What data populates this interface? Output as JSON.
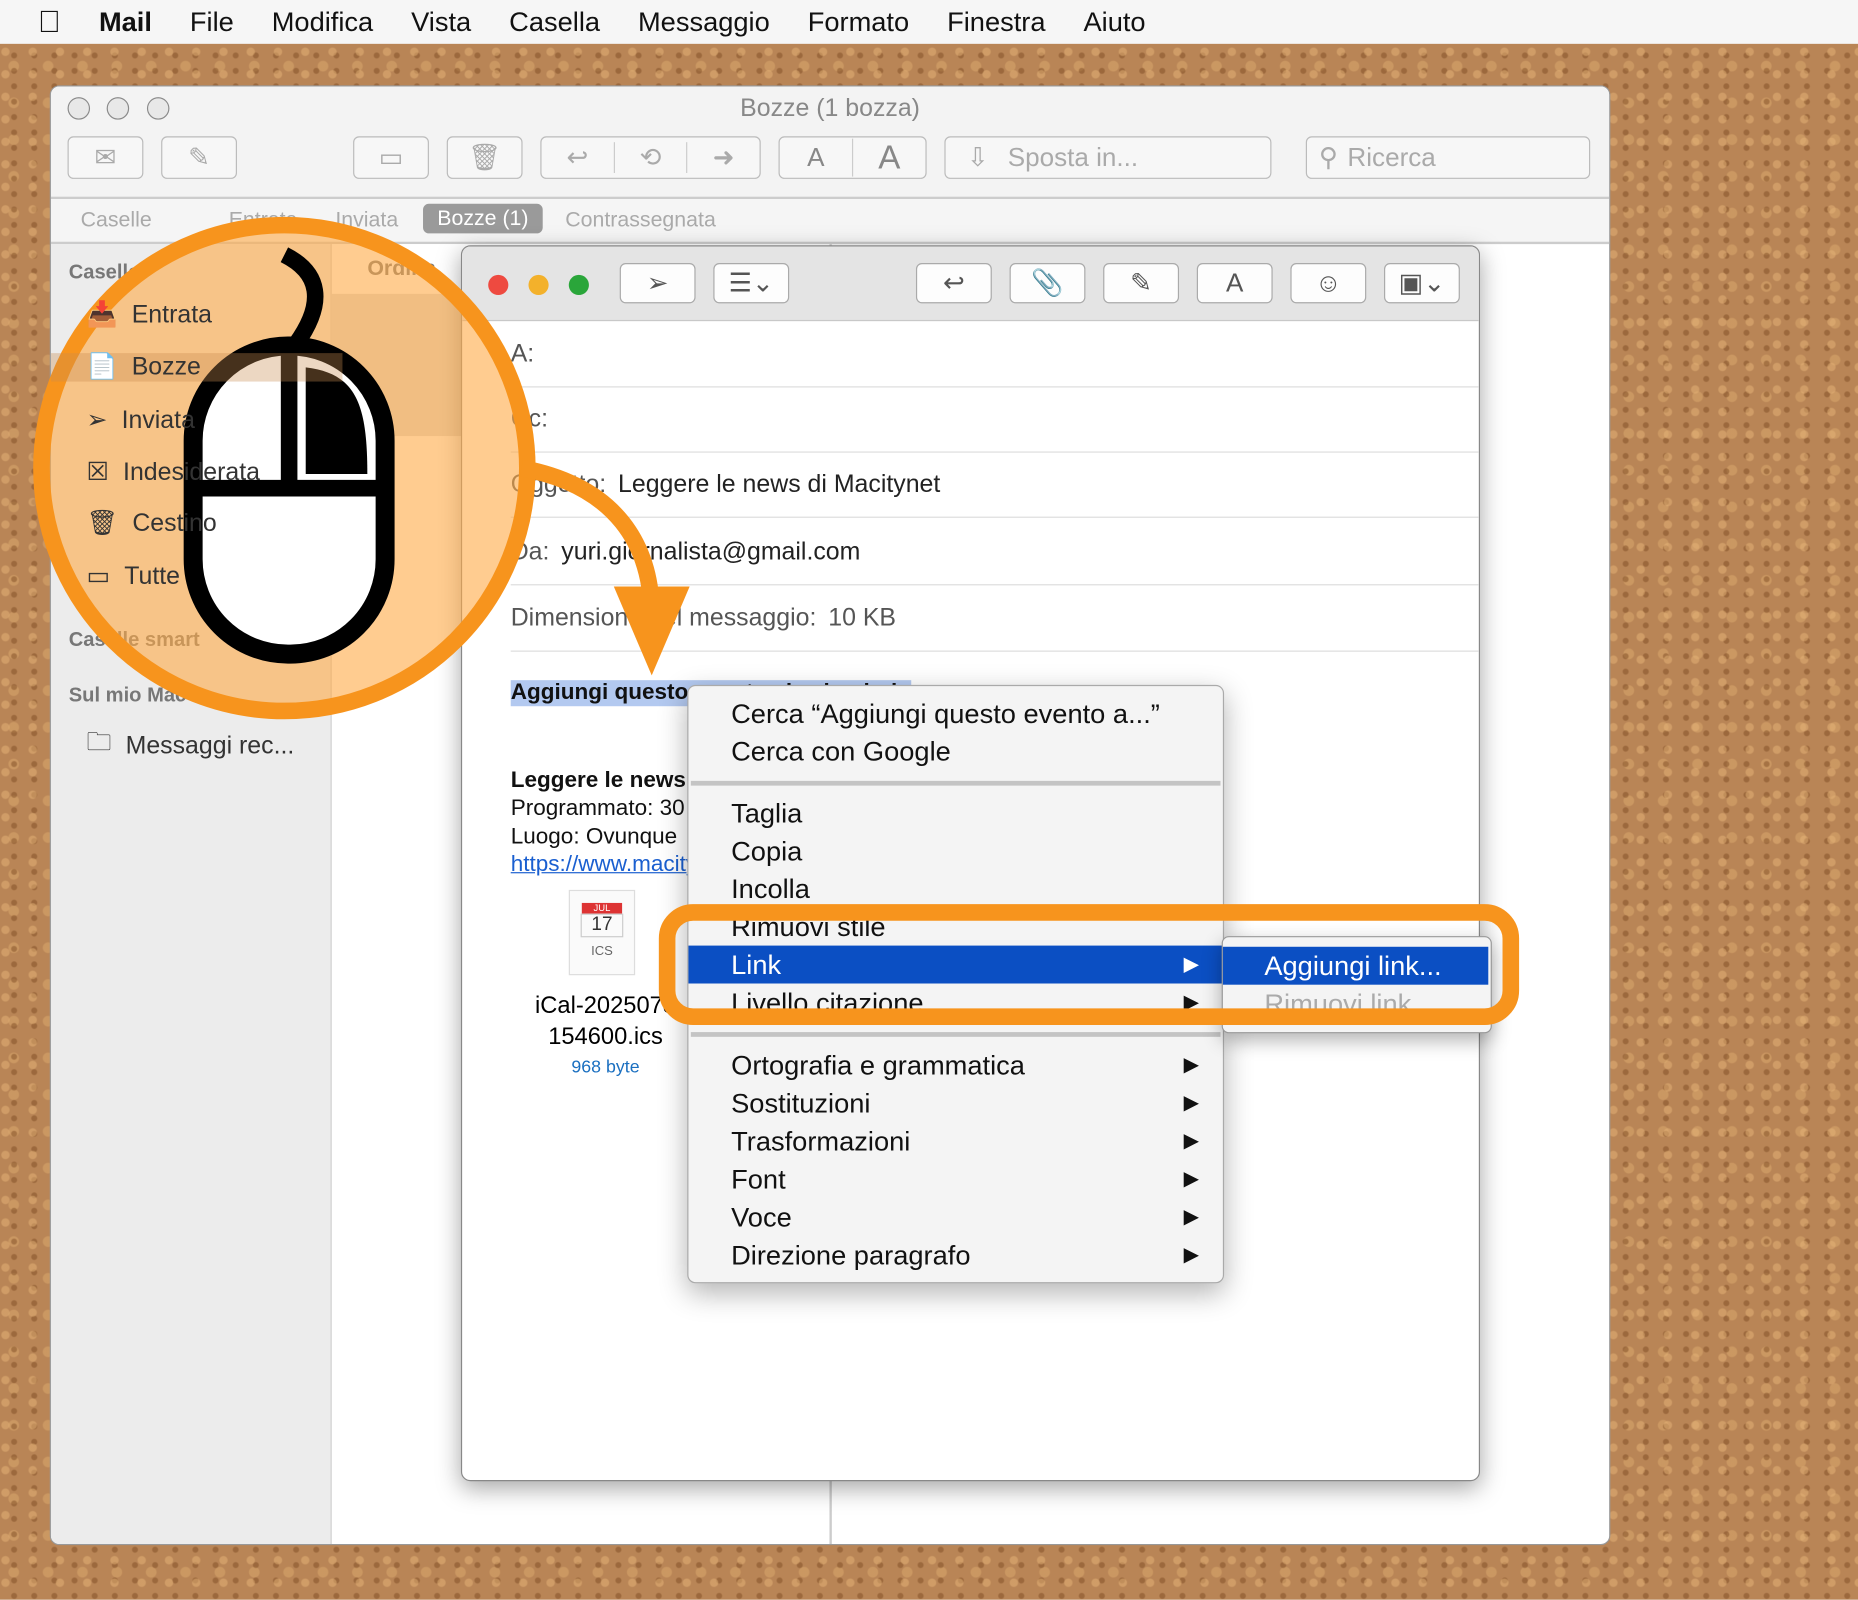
{
  "menubar": {
    "app": "Mail",
    "items": [
      "File",
      "Modifica",
      "Vista",
      "Casella",
      "Messaggio",
      "Formato",
      "Finestra",
      "Aiuto"
    ]
  },
  "main_window": {
    "title": "Bozze (1 bozza)",
    "move_label": "Sposta in...",
    "search_placeholder": "Ricerca",
    "tabs": [
      "Caselle",
      "Entrata",
      "Inviata",
      "Bozze (1)",
      "Contrassegnata"
    ],
    "sidebar": {
      "header": "Caselle",
      "items": [
        "Entrata",
        "Bozze",
        "Inviata",
        "Indesiderata",
        "Cestino",
        "Tutte"
      ],
      "smart": "Caselle smart",
      "onmac": "Sul mio Mac",
      "folder": "Messaggi rec..."
    },
    "list_sort": "Ordina"
  },
  "compose": {
    "to_label": "A:",
    "cc_label": "Cc:",
    "subject_label": "Oggetto:",
    "subject": "Leggere le news di Macitynet",
    "from_label": "Da:",
    "from": "yuri.giornalista@gmail.com",
    "size_label": "Dimensione del messaggio:",
    "size": "10 KB",
    "selected_text": "Aggiungi questo evento al calendario",
    "event_title": "Leggere le news",
    "scheduled": "Programmato: 30",
    "location": "Luogo: Ovunque",
    "link": "https://www.macitynet.it",
    "attachment": {
      "icon_month": "JUL",
      "icon_day": "17",
      "icon_type": "ICS",
      "name1": "iCal-2025073",
      "name2": "154600.ics",
      "size": "968 byte"
    }
  },
  "context_menu": {
    "items": [
      {
        "label": "Cerca “Aggiungi questo evento a...”"
      },
      {
        "label": "Cerca con Google"
      },
      {
        "label": "Taglia"
      },
      {
        "label": "Copia"
      },
      {
        "label": "Incolla"
      },
      {
        "label": "Rimuovi stile"
      },
      {
        "label": "Link",
        "submenu": true,
        "selected": true
      },
      {
        "label": "Livello citazione",
        "submenu": true
      },
      {
        "label": "Ortografia e grammatica",
        "submenu": true
      },
      {
        "label": "Sostituzioni",
        "submenu": true
      },
      {
        "label": "Trasformazioni",
        "submenu": true
      },
      {
        "label": "Font",
        "submenu": true
      },
      {
        "label": "Voce",
        "submenu": true
      },
      {
        "label": "Direzione paragrafo",
        "submenu": true
      }
    ],
    "submenu": [
      "Aggiungi link...",
      "Rimuovi link"
    ]
  },
  "colors": {
    "highlight": "#0b4fc3",
    "annotation": "#f7941d",
    "selection": "#b3c9f0"
  }
}
